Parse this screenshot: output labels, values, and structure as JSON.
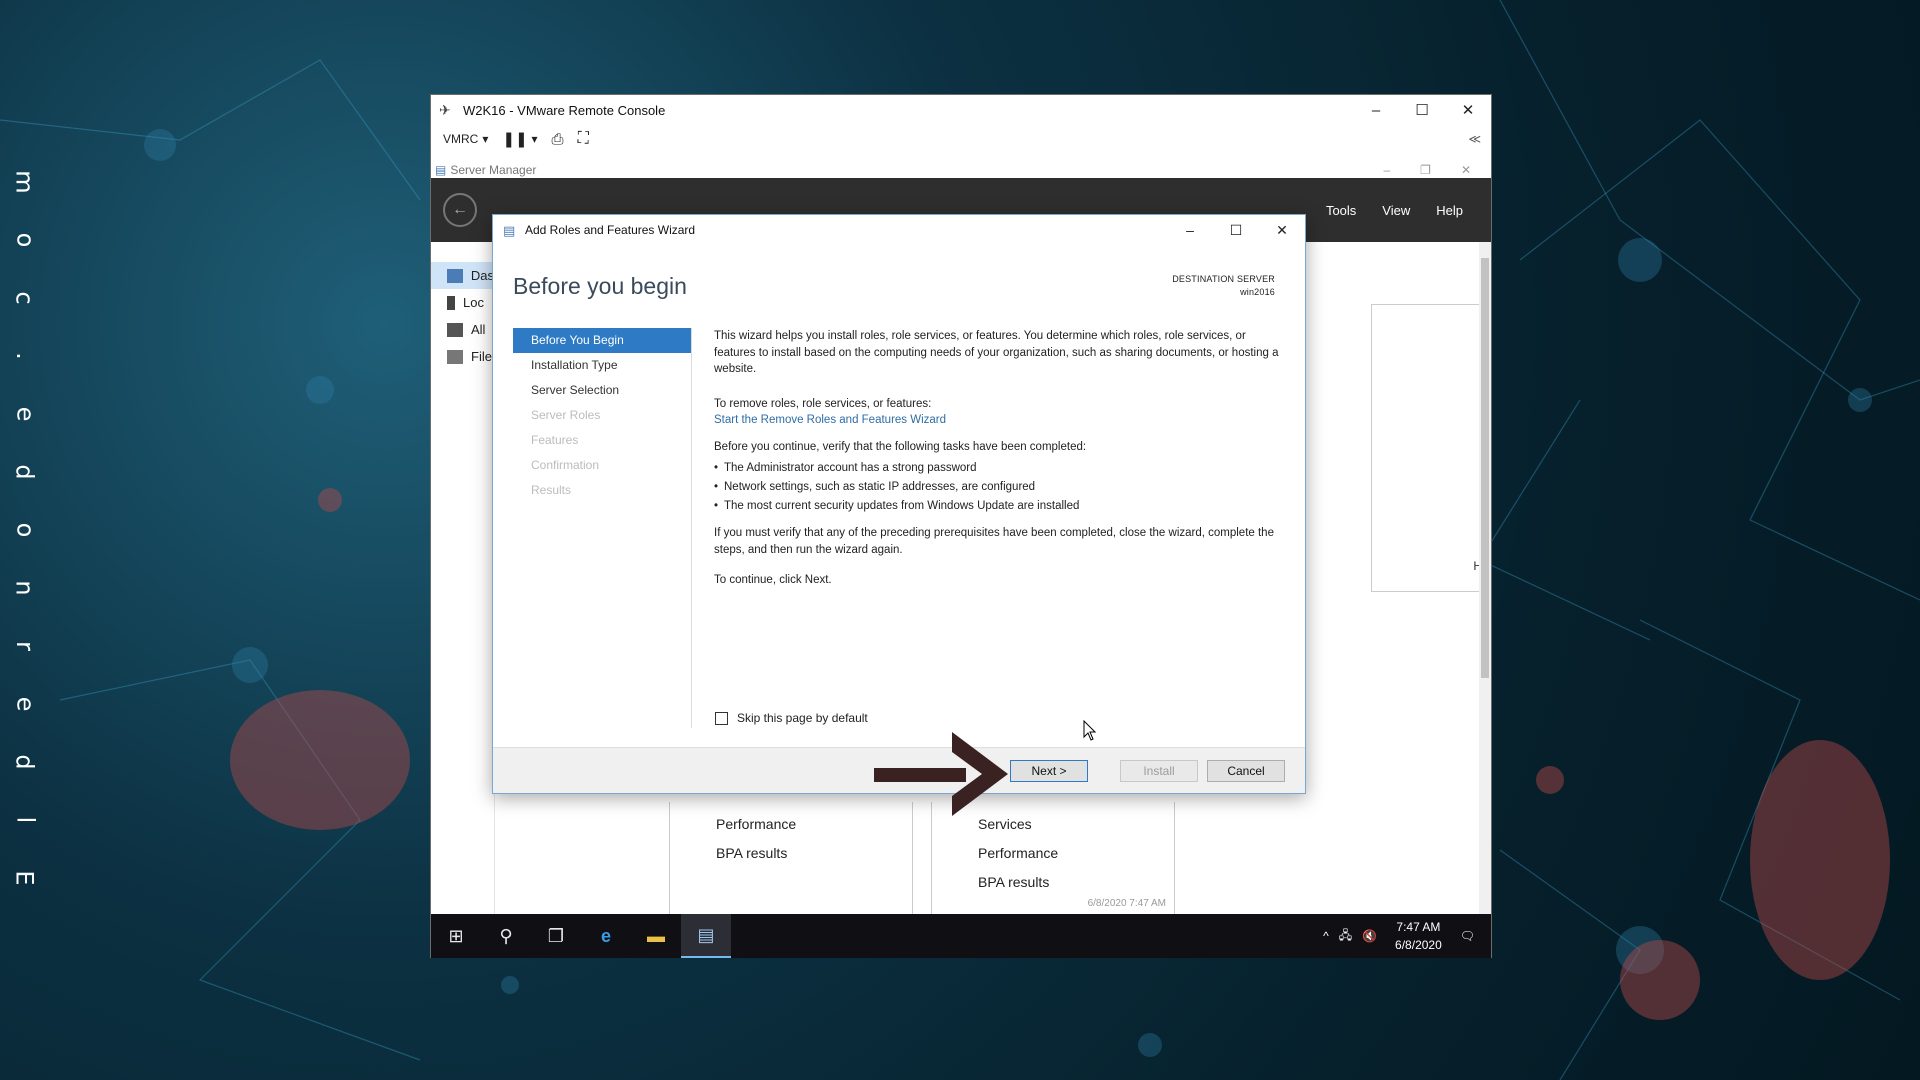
{
  "side_text": [
    "m",
    "o",
    "c",
    ".",
    "e",
    "d",
    "o",
    "n",
    "r",
    "e",
    "d",
    "l",
    "E"
  ],
  "vmrc": {
    "title": "W2K16 - VMware Remote Console",
    "menu_label": "VMRC",
    "controls": {
      "minimize": "–",
      "maximize": "☐",
      "close": "✕"
    },
    "collapse_glyph": "≪"
  },
  "server_manager": {
    "title": "Server Manager",
    "menu": [
      "Tools",
      "View",
      "Help"
    ],
    "sidebar": [
      {
        "label": "Das",
        "active": true
      },
      {
        "label": "Loc"
      },
      {
        "label": "All"
      },
      {
        "label": "File"
      }
    ],
    "welcome_hide": "Hide",
    "tile_left": [
      "Performance",
      "BPA results"
    ],
    "tile_right": [
      "Services",
      "Performance",
      "BPA results"
    ],
    "tile_timestamp": "6/8/2020 7:47 AM"
  },
  "taskbar": {
    "time": "7:47 AM",
    "date": "6/8/2020"
  },
  "wizard": {
    "title": "Add Roles and Features Wizard",
    "heading": "Before you begin",
    "destination_label": "DESTINATION SERVER",
    "destination_value": "win2016",
    "steps": [
      {
        "label": "Before You Begin",
        "state": "active"
      },
      {
        "label": "Installation Type",
        "state": "enabled"
      },
      {
        "label": "Server Selection",
        "state": "enabled"
      },
      {
        "label": "Server Roles",
        "state": "disabled"
      },
      {
        "label": "Features",
        "state": "disabled"
      },
      {
        "label": "Confirmation",
        "state": "disabled"
      },
      {
        "label": "Results",
        "state": "disabled"
      }
    ],
    "intro": "This wizard helps you install roles, role services, or features. You determine which roles, role services, or features to install based on the computing needs of your organization, such as sharing documents, or hosting a website.",
    "remove_text": "To remove roles, role services, or features:",
    "remove_link": "Start the Remove Roles and Features Wizard",
    "verify_text": "Before you continue, verify that the following tasks have been completed:",
    "tasks": [
      "The Administrator account has a strong password",
      "Network settings, such as static IP addresses, are configured",
      "The most current security updates from Windows Update are installed"
    ],
    "prereq_text": "If you must verify that any of the preceding prerequisites have been completed, close the wizard, complete the steps, and then run the wizard again.",
    "continue_text": "To continue, click Next.",
    "skip_label": "Skip this page by default",
    "buttons": {
      "next": "Next >",
      "install": "Install",
      "cancel": "Cancel"
    }
  }
}
